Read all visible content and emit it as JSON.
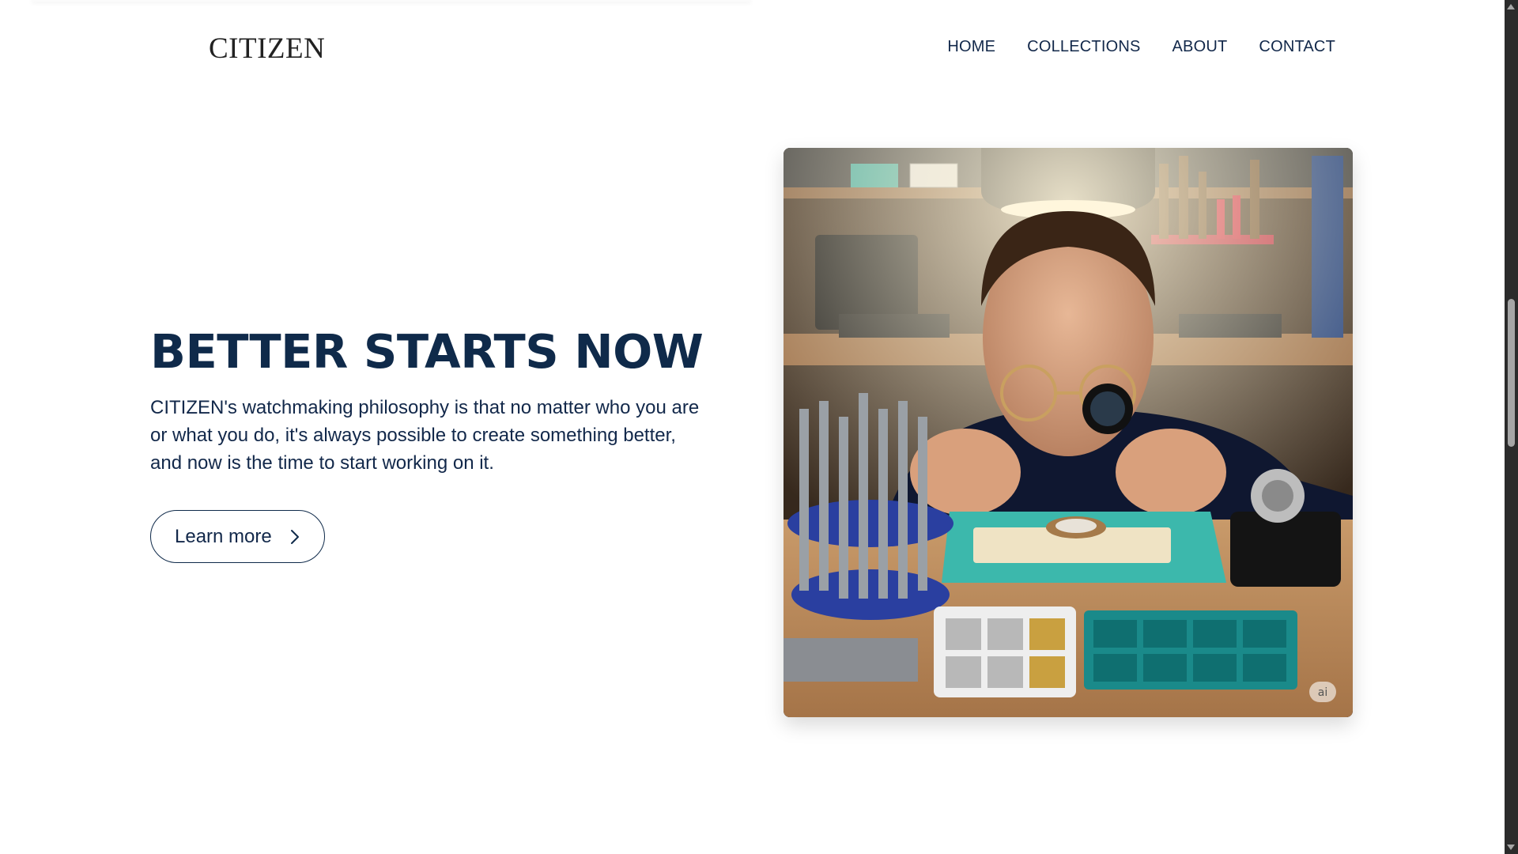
{
  "header": {
    "logo": "CITIZEN",
    "nav": [
      "HOME",
      "COLLECTIONS",
      "ABOUT",
      "CONTACT"
    ]
  },
  "hero": {
    "headline": "BETTER STARTS NOW",
    "description": "CITIZEN's watchmaking philosophy is that no matter who you are or what you do, it's always possible to create something better, and now is the time to start working on it.",
    "button_label": "Learn more",
    "button_icon": "chevron-right-icon",
    "image_badge": "ai"
  },
  "colors": {
    "navy": "#0f2a4a",
    "background": "#ffffff",
    "scrollbar": "#2b2b2b"
  }
}
